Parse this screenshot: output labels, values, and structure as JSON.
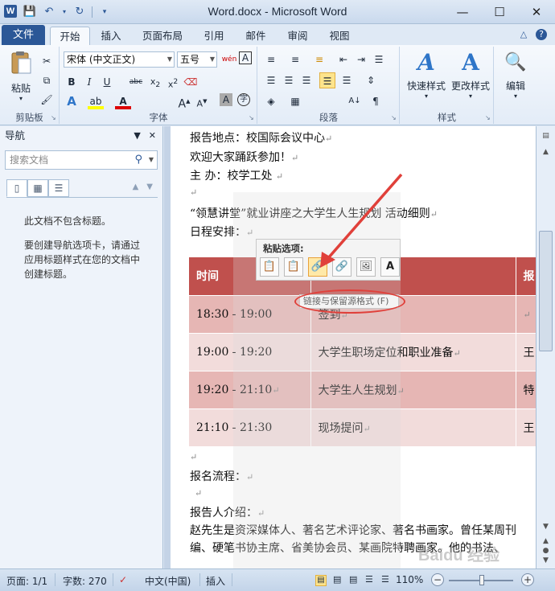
{
  "app": {
    "logo_letter": "W",
    "title": "Word.docx - Microsoft Word"
  },
  "tabs": {
    "file": "文件",
    "items": [
      "开始",
      "插入",
      "页面布局",
      "引用",
      "邮件",
      "审阅",
      "视图"
    ],
    "active": "开始"
  },
  "ribbon": {
    "clipboard": {
      "paste": "粘贴",
      "label": "剪贴板"
    },
    "font": {
      "name": "宋体 (中文正文)",
      "size": "五号",
      "wen": "wén",
      "label": "字体"
    },
    "paragraph": {
      "label": "段落"
    },
    "styles": {
      "quick": "快速样式",
      "change": "更改样式",
      "label": "样式"
    },
    "editing": {
      "label": "编辑"
    }
  },
  "nav": {
    "title": "导航",
    "search_placeholder": "搜索文档",
    "message1": "此文档不包含标题。",
    "message2": "要创建导航选项卡，请通过应用标题样式在您的文档中创建标题。"
  },
  "document": {
    "lines": [
      "报告地点：校国际会议中心",
      "欢迎大家踊跃参加！",
      "主  办：校学工处",
      "“领慧讲堂”就业讲座之大学生人生规划   活动细则",
      "日程安排：",
      "报名流程：",
      "报告人介绍：",
      "赵先生是资深媒体人、著名艺术评论家、著名书画家。曾任某周刊",
      "编、硬笔书协主席、省美协会员、某画院特聘画家。他的书法、"
    ],
    "table": {
      "headers": [
        "时间",
        "",
        "报"
      ],
      "rows": [
        [
          "18:30 - 19:00",
          "签到",
          ""
        ],
        [
          "19:00 - 19:20",
          "大学生职场定位和职业准备",
          "王"
        ],
        [
          "19:20 - 21:10",
          "大学生人生规划",
          "特"
        ],
        [
          "21:10 - 21:30",
          "现场提问",
          "王"
        ]
      ]
    }
  },
  "paste_options": {
    "title": "粘贴选项:",
    "tooltip": "链接与保留源格式 (F)"
  },
  "status": {
    "page": "页面: 1/1",
    "words": "字数: 270",
    "language": "中文(中国)",
    "mode": "插入",
    "zoom": "110%"
  },
  "watermark": "Baidu 经验",
  "colors": {
    "accent": "#2b5797",
    "table_header": "#c0504d",
    "table_odd": "#e6b6b4",
    "table_even": "#f2dcdb",
    "annotation": "#e0403a"
  }
}
